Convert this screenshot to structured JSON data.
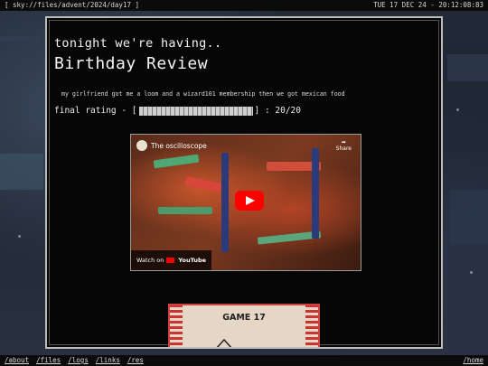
{
  "topbar": {
    "path": "[ sky://files/advent/2024/day17 ]",
    "datetime": "TUE 17 DEC 24 - 20:12:08:83"
  },
  "post": {
    "subtitle": "tonight we're having..",
    "title": "Birthday Review",
    "body": "my girlfriend got me a loom and a wizard101 membership then we got mexican food",
    "rating_label": "final rating - [",
    "rating_close": "] : 20/20",
    "rating_value": 20,
    "rating_max": 20
  },
  "video": {
    "channel_title": "The oscilloscope",
    "share_label": "Share",
    "watch_on": "Watch on",
    "platform": "YouTube"
  },
  "image": {
    "caption_text": "GAME 17"
  },
  "nav": {
    "about": "/about",
    "files": "/files",
    "logs": "/logs",
    "links": "/links",
    "res": "/res",
    "home": "/home"
  },
  "colors": {
    "frame": "#bdbdbd",
    "panel": "#060606",
    "text": "#f2f2f2",
    "play": "#ff0000"
  }
}
